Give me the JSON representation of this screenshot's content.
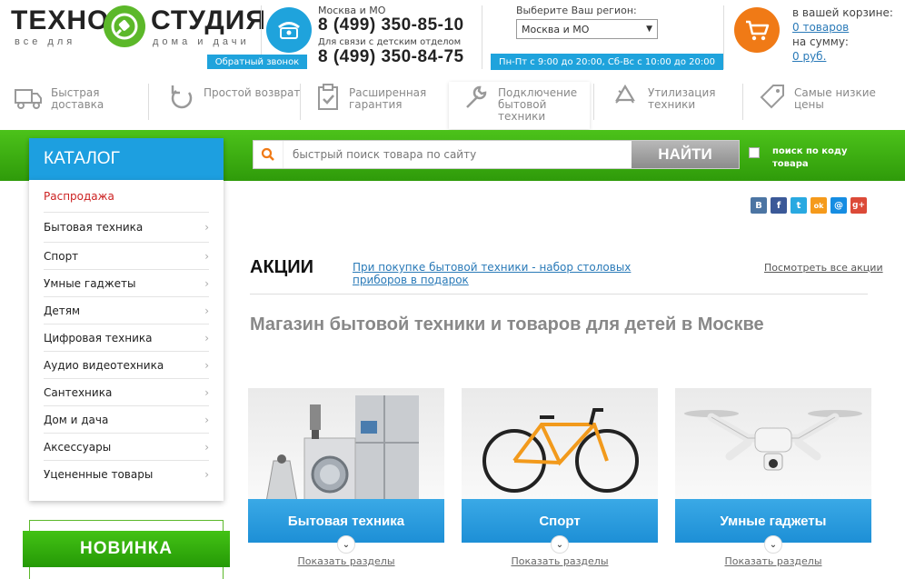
{
  "header": {
    "logo_left": "ТЕХНО",
    "logo_right": "СТУДИЯ",
    "logo_sub_left": "все для",
    "logo_sub_right": "дома и дачи",
    "region_moscow": "Москва и МО",
    "phone1": "8 (499) 350-85-10",
    "kids_label": "Для связи с детским отделом",
    "phone2": "8 (499) 350-84-75",
    "callback": "Обратный звонок",
    "region_label": "Выберите Ваш регион:",
    "region_value": "Москва и МО",
    "hours": "Пн-Пт с 9:00 до 20:00, Сб-Вс с 10:00 до 20:00",
    "cart_label": "в вашей корзине:",
    "cart_items": "0 товаров",
    "cart_sum_label": "на сумму:",
    "cart_sum": "0 руб."
  },
  "features": [
    {
      "icon": "truck-icon",
      "label": "Быстрая\nдоставка"
    },
    {
      "icon": "return-icon",
      "label": "Простой возврат"
    },
    {
      "icon": "clipboard-check-icon",
      "label": "Расширенная\nгарантия"
    },
    {
      "icon": "wrench-icon",
      "label": "Подключение\nбытовой\nтехники"
    },
    {
      "icon": "recycle-icon",
      "label": "Утилизация\nтехники"
    },
    {
      "icon": "price-tag-icon",
      "label": "Самые низкие\nцены"
    }
  ],
  "catalog": {
    "title": "КАТАЛОГ",
    "items": [
      "Распродажа",
      "Бытовая техника",
      "Спорт",
      "Умные гаджеты",
      "Детям",
      "Цифровая техника",
      "Аудио видеотехника",
      "Сантехника",
      "Дом и дача",
      "Аксессуары",
      "Уцененные товары"
    ]
  },
  "search": {
    "placeholder": "быстрый поиск товара по сайту",
    "button": "НАЙТИ",
    "code_label": "поиск по коду товара"
  },
  "social": [
    "B",
    "f",
    "t",
    "ok",
    "@",
    "g+"
  ],
  "promo": {
    "title": "АКЦИИ",
    "link": "При покупке бытовой техники - набор столовых приборов в подарок",
    "all": "Посмотреть все акции"
  },
  "main_title": "Магазин бытовой техники и товаров для детей в Москве",
  "cards": [
    {
      "label": "Бытовая техника",
      "show": "Показать разделы"
    },
    {
      "label": "Спорт",
      "show": "Показать разделы"
    },
    {
      "label": "Умные гаджеты",
      "show": "Показать разделы"
    }
  ],
  "novinka": "НОВИНКА",
  "colors": {
    "green": "#3fb515",
    "blue": "#1d9fe0",
    "orange": "#f07a16"
  }
}
